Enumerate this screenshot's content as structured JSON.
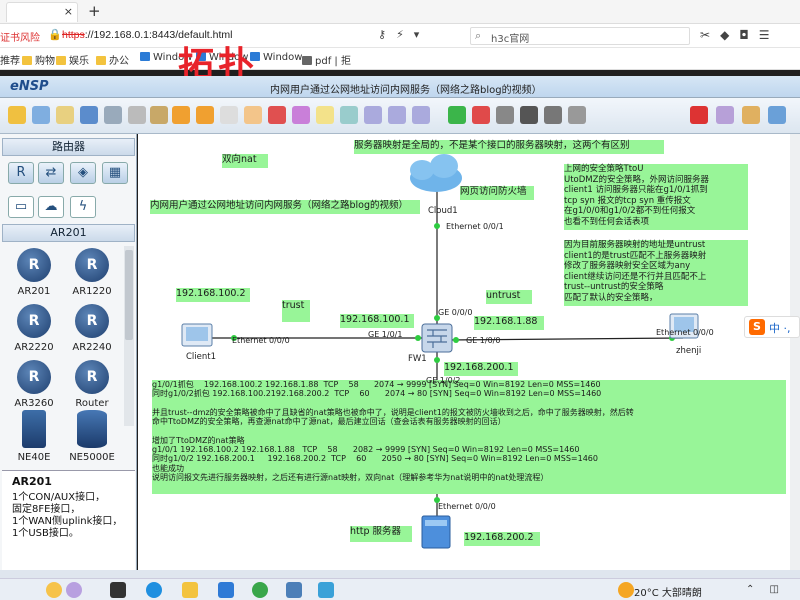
{
  "browser": {
    "risk_badge": "证书风险",
    "url_scheme": "https",
    "url_rest": "://192.168.0.1:8443/default.html",
    "search_value": "h3c官网",
    "new_tab": "+",
    "tab_close": "×"
  },
  "bookmarks": [
    "推荐",
    "购物",
    "娱乐",
    "办公",
    "Window",
    "Window",
    "Window",
    "pdf | 拒"
  ],
  "overlay_title": "拓扑",
  "ensp": {
    "logo": "eNSP",
    "caption": "内网用户通过公网地址访问内网服务（网络之路blog的视频）"
  },
  "left_panel": {
    "category_header": "路由器",
    "category_icons": [
      "router-category-icon",
      "switch-category-icon",
      "wireless-category-icon",
      "firewall-category-icon",
      "pc-category-icon",
      "cloud-category-icon",
      "power-category-icon"
    ],
    "subheader": "AR201",
    "devices": [
      "AR201",
      "AR1220",
      "AR2220",
      "AR2240",
      "AR3260",
      "Router",
      "NE40E",
      "NE5000E"
    ],
    "desc_title": "AR201",
    "desc_lines": [
      "1个CON/AUX接口，",
      "固定8FE接口，",
      "1个WAN侧uplink接口，",
      "1个USB接口。"
    ]
  },
  "topology": {
    "notes": {
      "top_banner": "服务器映射是全局的，不是某个接口的服务器映射，这两个有区别",
      "double_nat": "双向nat",
      "project_title": "内网用户通过公网地址访问内网服务（网络之路blog的视频）",
      "firewall_web": "网页访问防火墙",
      "client_ip": "192.168.100.2",
      "trust": "trust",
      "untrust": "untrust",
      "fw_inside_ip": "192.168.100.1",
      "fw_outside_ip": "192.168.1.88",
      "fw_dmz_ip": "192.168.200.1",
      "http_server": "http 服务器",
      "server_ip": "192.168.200.2",
      "right_note_p1": "上网的安全策略TtoU\nUtoDMZ的安全策略，外网访问服务器\nclient1 访问服务器只能在g1/0/1抓到\ntcp syn 报文的tcp syn 重传报文\n在g1/0/0和g1/0/2都不到任何报文\n也看不到任何会话表项",
      "right_note_p2": "因为目前服务器映射的地址是untrust\nclient1的是trust匹配不上服务器映射\n修改了服务器映射安全区域为any\nclient继续访问还是不行并且匹配不上\ntrust--untrust的安全策略\n匹配了默认的安全策略，",
      "capture_block": "g1/0/1抓包    192.168.100.2 192.168.1.88  TCP    58      2074 → 9999 [SYN] Seq=0 Win=8192 Len=0 MSS=1460\n同时g1/0/2抓包 192.168.100.2192.168.200.2  TCP    60      2074 → 80 [SYN] Seq=0 Win=8192 Len=0 MSS=1460\n\n并且trust--dmz的安全策略被命中了且缺省的nat策略也被命中了，说明是client1的报文被防火墙收到之后，命中了服务器映射，然后转\n命中TtoDMZ的安全策略，再查源nat命中了源nat，最后建立回话（查会话表有服务器映射的回话）\n\n增加了TtoDMZ的nat策略\ng1/0/1 192.168.100.2 192.168.1.88   TCP    58      2082 → 9999 [SYN] Seq=0 Win=8192 Len=0 MSS=1460\n同时g1/0/2 192.168.200.1     192.168.200.2  TCP    60      2050 → 80 [SYN] Seq=0 Win=8192 Len=0 MSS=1460\n也能成功\n说明访问报文先进行服务器映射，之后还有进行源nat映射，双向nat（理解参考华为nat说明中的nat处理流程）"
    },
    "devices": {
      "cloud": "Cloud1",
      "client": "Client1",
      "firewall": "FW1",
      "right_host": "zhenji"
    },
    "interfaces": {
      "cloud_eth": "Ethernet 0/0/1",
      "fw_ge000": "GE 0/0/0",
      "fw_ge101": "GE 1/0/1",
      "fw_ge100": "GE 1/0/0",
      "fw_ge102": "GE 1/0/2",
      "client_eth": "Ethernet 0/0/0",
      "zhenji_eth": "Ethernet 0/0/0",
      "server_eth": "Ethernet 0/0/0"
    }
  },
  "ime_float": {
    "logo": "S",
    "text": "中 ·,"
  },
  "taskbar": {
    "weather": "20°C 大部晴朗"
  }
}
